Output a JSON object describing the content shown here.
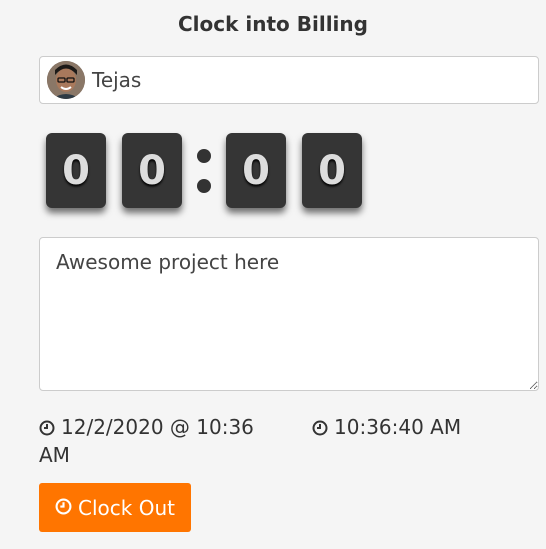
{
  "header": {
    "title": "Clock into Billing"
  },
  "user": {
    "name": "Tejas",
    "avatar_icon": "user-avatar"
  },
  "timer": {
    "digits": [
      "0",
      "0",
      "0",
      "0"
    ]
  },
  "notes": {
    "value": "Awesome project here"
  },
  "meta": {
    "start": "12/2/2020 @ 10:36 AM",
    "current_time": "10:36:40 AM"
  },
  "actions": {
    "clock_out_label": "Clock Out"
  },
  "colors": {
    "accent": "#ff7500",
    "digit_bg": "#353535"
  }
}
